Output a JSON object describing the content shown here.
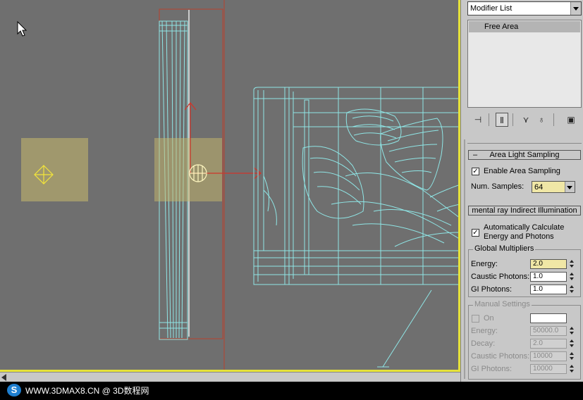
{
  "watermark": {
    "logo_text": "S",
    "text": "WWW.3DMAX8.CN @ 3D数程网"
  },
  "panel": {
    "modifier_list": "Modifier List",
    "stack_item": "Free Area",
    "tools": [
      "pin-stack",
      "show-end-result",
      "make-unique",
      "remove-modifier",
      "configure-modifier-sets"
    ],
    "area_light_sampling": {
      "title": "Area Light Sampling",
      "enable_label": "Enable Area Sampling",
      "enable_checked": true,
      "num_samples_label": "Num. Samples:",
      "num_samples_value": "64"
    },
    "indirect": {
      "title": "mental ray Indirect Illumination",
      "auto_label_1": "Automatically Calculate",
      "auto_label_2": "Energy and Photons",
      "auto_checked": true,
      "global_title": "Global Multipliers",
      "energy_label": "Energy:",
      "energy_value": "2.0",
      "caustic_label": "Caustic Photons:",
      "caustic_value": "1.0",
      "gi_label": "GI Photons:",
      "gi_value": "1.0",
      "manual_title": "Manual Settings",
      "on_label": "On",
      "m_energy_label": "Energy:",
      "m_energy_value": "50000.0",
      "m_decay_label": "Decay:",
      "m_decay_value": "2.0",
      "m_caustic_label": "Caustic Photons:",
      "m_caustic_value": "10000",
      "m_gi_label": "GI Photons:",
      "m_gi_value": "10000"
    }
  },
  "colors": {
    "viewport_bg": "#6f6f6f",
    "active_border": "#e6e23a",
    "wire": "#8fe6e6",
    "light_area": "#c9b96c",
    "selection": "#c0392b"
  }
}
